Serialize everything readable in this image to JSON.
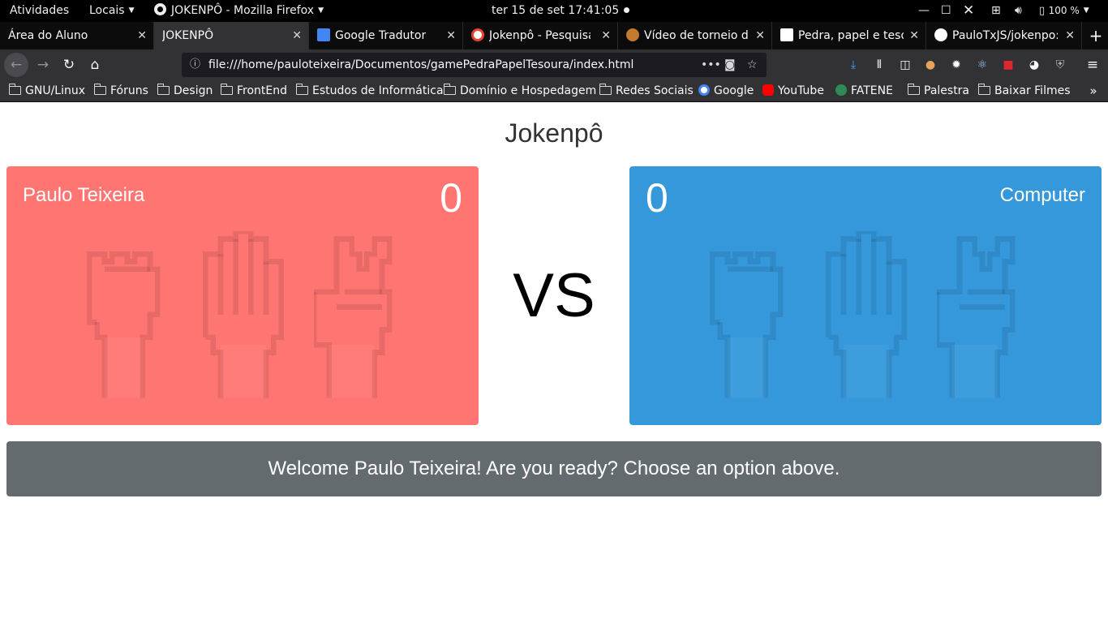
{
  "topbar": {
    "activities": "Atividades",
    "places": "Locais",
    "app_title": "JOKENPÔ - Mozilla Firefox",
    "clock": "ter 15 de set  17:41:05",
    "battery": "100 %"
  },
  "tabs": [
    {
      "label": "Área do Aluno",
      "active": false
    },
    {
      "label": "JOKENPÔ",
      "active": true
    },
    {
      "label": "Google Tradutor",
      "active": false
    },
    {
      "label": "Jokenpô - Pesquisa",
      "active": false
    },
    {
      "label": "Vídeo de torneio de",
      "active": false
    },
    {
      "label": "Pedra, papel e tesou",
      "active": false
    },
    {
      "label": "PauloTxJS/jokenpo:",
      "active": false
    }
  ],
  "navbar": {
    "url": "file:///home/pauloteixeira/Documentos/gamePedraPapelTesoura/index.html"
  },
  "bookmarks": [
    {
      "label": "GNU/Linux",
      "type": "folder"
    },
    {
      "label": "Fóruns",
      "type": "folder"
    },
    {
      "label": "Design",
      "type": "folder"
    },
    {
      "label": "FrontEnd",
      "type": "folder"
    },
    {
      "label": "Estudos de Informática",
      "type": "folder"
    },
    {
      "label": "Domínio e Hospedagem",
      "type": "folder"
    },
    {
      "label": "Redes Sociais",
      "type": "folder"
    },
    {
      "label": "Google",
      "type": "link"
    },
    {
      "label": "YouTube",
      "type": "link"
    },
    {
      "label": "FATENE",
      "type": "link"
    },
    {
      "label": "Palestra",
      "type": "folder"
    },
    {
      "label": "Baixar Filmes",
      "type": "folder"
    }
  ],
  "game": {
    "title": "Jokenpô",
    "player": {
      "name": "Paulo Teixeira",
      "score": "0",
      "color": "#ff7571"
    },
    "computer": {
      "name": "Computer",
      "score": "0",
      "color": "#3498db"
    },
    "vs": "VS",
    "options": [
      "rock-hand-icon",
      "paper-hand-icon",
      "scissors-hand-icon"
    ],
    "message": "Welcome Paulo Teixeira! Are you ready? Choose an option above."
  }
}
